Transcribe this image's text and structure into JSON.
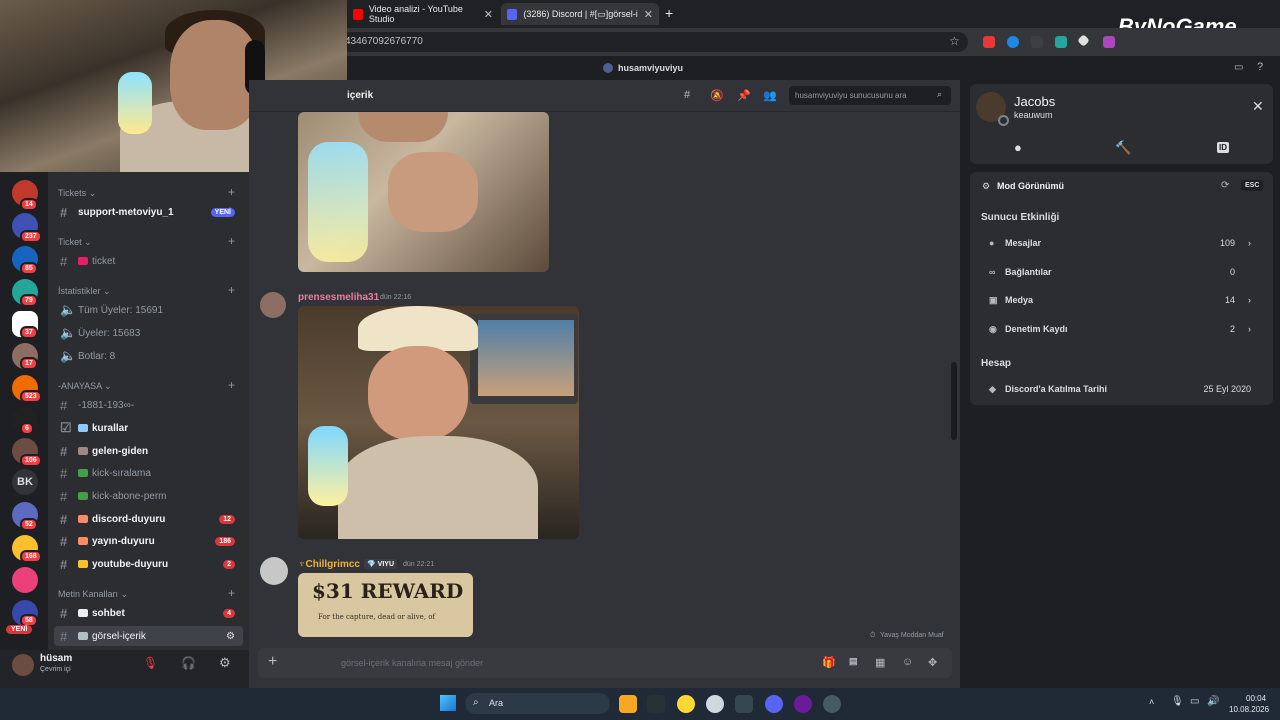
{
  "browser": {
    "tabs": [
      {
        "label": "Video analizi - YouTube Studio"
      },
      {
        "label": "(3286) Discord | #[▭]görsel-i..."
      }
    ],
    "url": "43467092676770",
    "watermark": "ByNoGame"
  },
  "discord": {
    "title_user": "husamviyuviyu",
    "channel_header": "içerik",
    "search_placeholder": "husamviyuviyu sunucusunu ara",
    "categories": [
      {
        "label": "Tickets ⌄"
      },
      {
        "label": "Ticket ⌄"
      },
      {
        "label": "İstatistikler ⌄"
      },
      {
        "label": "-ANAYASA ⌄"
      },
      {
        "label": "Metin Kanalları ⌄"
      }
    ],
    "channels": {
      "support": {
        "label": "support-metoviyu_1",
        "badge": "YENİ"
      },
      "ticket": {
        "label": "ticket"
      },
      "stat_members": {
        "label": "Tüm Üyeler: 15691"
      },
      "stat_users": {
        "label": "Üyeler: 15683"
      },
      "stat_bots": {
        "label": "Botlar: 8"
      },
      "anayasa_year": {
        "label": "-1881-193∞-"
      },
      "kurallar": {
        "label": "kurallar"
      },
      "gelen_giden": {
        "label": "gelen-giden"
      },
      "kick_siralama": {
        "label": "kick-sıralama"
      },
      "kick_abone": {
        "label": "kick-abone-perm"
      },
      "discord_duyuru": {
        "label": "discord-duyuru",
        "badge": "12"
      },
      "yayin_duyuru": {
        "label": "yayın-duyuru",
        "badge": "186"
      },
      "youtube_duyuru": {
        "label": "youtube-duyuru",
        "badge": "2"
      },
      "sohbet": {
        "label": "sohbet",
        "badge": "4"
      },
      "gorsel_icerik": {
        "label": "görsel-içerik"
      }
    },
    "server_badges": [
      "14",
      "237",
      "85",
      "79",
      "37",
      "17",
      "523",
      "6",
      "106",
      "52",
      "168",
      "58"
    ],
    "server_bk": "BK",
    "server_new": "YENİ",
    "user": {
      "name": "hüsam",
      "status": "Çevrim içi"
    },
    "messages": [
      {
        "author": "prensesmeliha31",
        "time": "dün 22:16"
      },
      {
        "author": "♆Chillgrimcc",
        "tag": "💎 VIYU",
        "time": "dün 22:21",
        "image_text": "$31 REWARD",
        "image_subtext": "For the capture, dead or alive, of"
      }
    ],
    "slowmode_note": "Yavaş Moddan Muaf",
    "composer_placeholder": "görsel-içerik kanalına mesaj gönder"
  },
  "profile": {
    "name": "Jacobs",
    "handle": "keauwum",
    "mod_view": "Mod Görünümü",
    "esc": "ESC",
    "activity_title": "Sunucu Etkinliği",
    "activity": [
      {
        "label": "Mesajlar",
        "value": "109"
      },
      {
        "label": "Bağlantılar",
        "value": "0"
      },
      {
        "label": "Medya",
        "value": "14"
      },
      {
        "label": "Denetim Kaydı",
        "value": "2"
      }
    ],
    "account_title": "Hesap",
    "joined_label": "Discord'a Katılma Tarihi",
    "joined_value": "25 Eyl 2020"
  },
  "taskbar": {
    "search": "Ara",
    "time": "00:04",
    "date": "10.08.2026"
  }
}
